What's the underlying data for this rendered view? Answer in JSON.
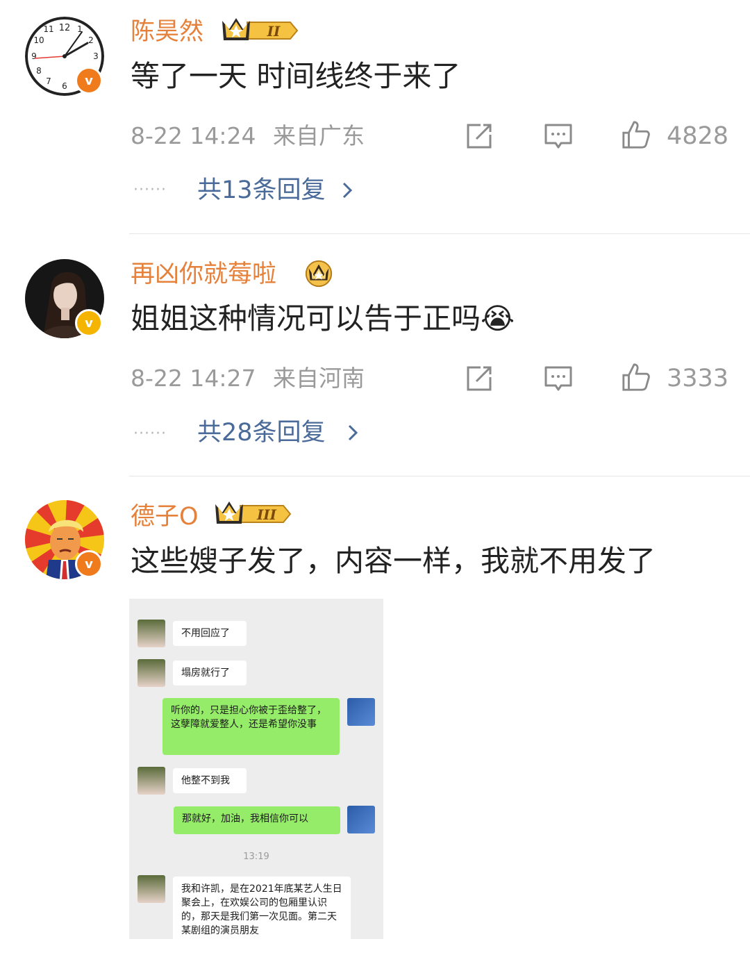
{
  "comments": [
    {
      "username": "陈昊然",
      "crown_level": "II",
      "text": "等了一天 时间线终于来了",
      "time": "8-22 14:24",
      "location": "来自广东",
      "likes": "4828",
      "replies_dots": "······",
      "replies": "共13条回复"
    },
    {
      "username": "再凶你就莓啦",
      "text": "姐姐这种情况可以告于正吗😭",
      "time": "8-22 14:27",
      "location": "来自河南",
      "likes": "3333",
      "replies_dots": "······",
      "replies": "共28条回复"
    },
    {
      "username": "德子O",
      "crown_level": "III",
      "text": "这些嫂子发了，内容一样，我就不用发了"
    }
  ],
  "chat": {
    "messages": [
      {
        "side": "left",
        "text": "不用回应了"
      },
      {
        "side": "left",
        "text": "塌房就行了"
      },
      {
        "side": "right",
        "text": "听你的，只是担心你被于歪给整了，这孽障就爱整人，还是希望你没事"
      },
      {
        "side": "left",
        "text": "他整不到我"
      },
      {
        "side": "right",
        "text": "那就好，加油，我相信你可以"
      },
      {
        "side": "left",
        "text": "我和许凯，是在2021年底某艺人生日聚会上，在欢娱公司的包厢里认识的，那天是我们第一次见面。第二天某剧组的演员朋友"
      }
    ],
    "timestamp": "13:19"
  },
  "colors": {
    "username": "#e5813b",
    "reply_link": "#4a6a99",
    "meta_gray": "#9a9a9a",
    "verified_orange": "#f07b1d",
    "verified_gold": "#f4b400",
    "wechat_green": "#95ec69"
  },
  "icons": [
    "clock-avatar",
    "verified-badge-icon",
    "crown-badge-icon",
    "repost-icon",
    "comment-icon",
    "like-icon",
    "chevron-right-icon"
  ]
}
